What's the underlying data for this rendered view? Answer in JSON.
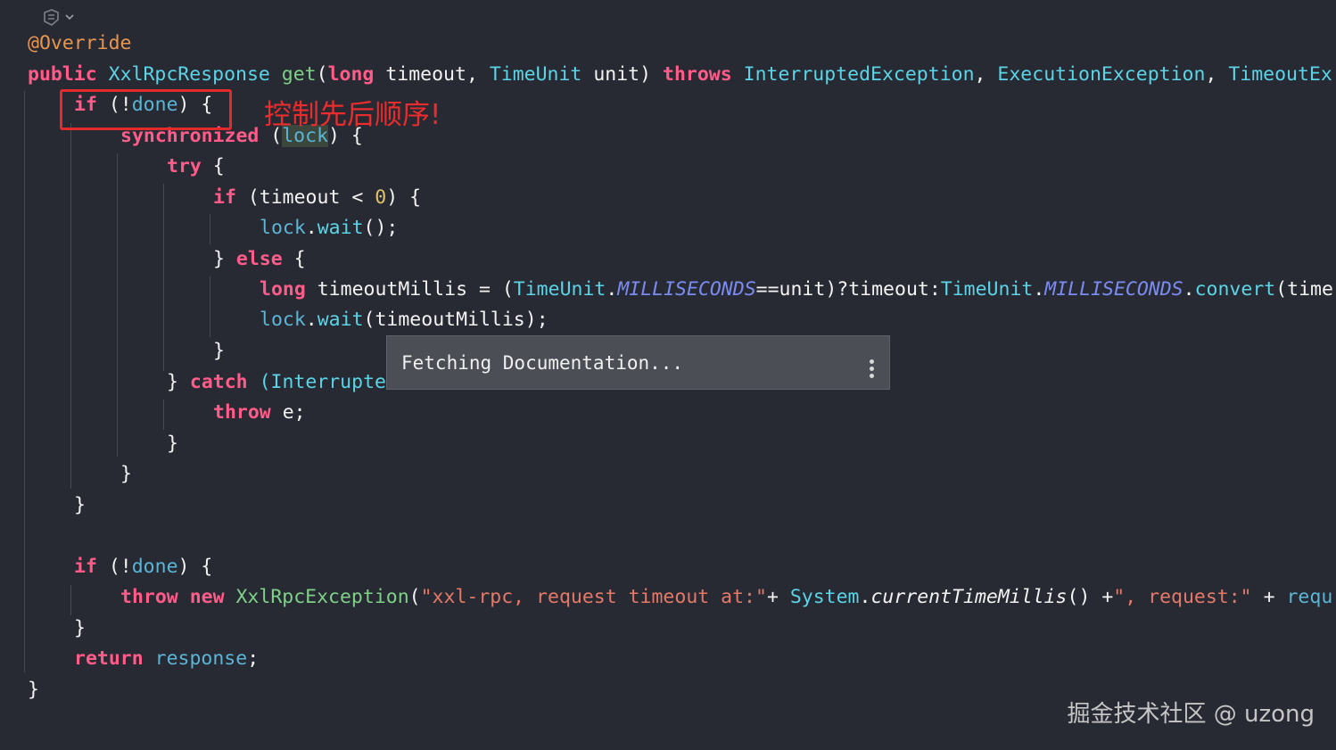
{
  "annotation": {
    "text": "控制先后顺序!",
    "box_color": "#e42a2a"
  },
  "popup": {
    "text": "Fetching Documentation...",
    "menu_icon": "more-vertical-icon"
  },
  "gutter": {
    "icon": "ai-assistant-icon"
  },
  "watermark": "掘金技术社区 @ uzong",
  "colors": {
    "background": "#282a33",
    "keyword": "#ff5c8a",
    "type": "#5ad4e6",
    "string": "#e57968",
    "annotation": "#e89550"
  },
  "code": {
    "annotation_line": "@Override",
    "signature": {
      "kw_public": "public",
      "return_type": "XxlRpcResponse",
      "method_name": "get",
      "kw_long": "long",
      "param_timeout": "timeout",
      "type_timeunit": "TimeUnit",
      "param_unit": "unit",
      "kw_throws": "throws",
      "exc1": "InterruptedException",
      "exc2": "ExecutionException",
      "exc3": "TimeoutEx"
    },
    "kw_if": "if",
    "field_done": "done",
    "kw_synchronized": "synchronized",
    "field_lock": "lock",
    "kw_try": "try",
    "var_timeout": "timeout",
    "num_zero": "0",
    "method_wait": "wait",
    "kw_else": "else",
    "kw_long": "long",
    "var_timeoutMillis": "timeoutMillis",
    "type_timeunit": "TimeUnit",
    "const_ms": "MILLISECONDS",
    "var_unit": "unit",
    "method_convert": "convert",
    "cut_time": "(time",
    "kw_catch": "catch",
    "catch_type_visible": "(Interrupte",
    "kw_throw": "throw",
    "var_e": "e",
    "kw_new": "new",
    "exc_class": "XxlRpcException",
    "str_timeout": "\"xxl-rpc, request timeout at:\"",
    "type_system": "System",
    "method_ctm": "currentTimeMillis",
    "str_request": "\", request:\"",
    "cut_requ": "requ",
    "kw_return": "return",
    "field_response": "response"
  }
}
